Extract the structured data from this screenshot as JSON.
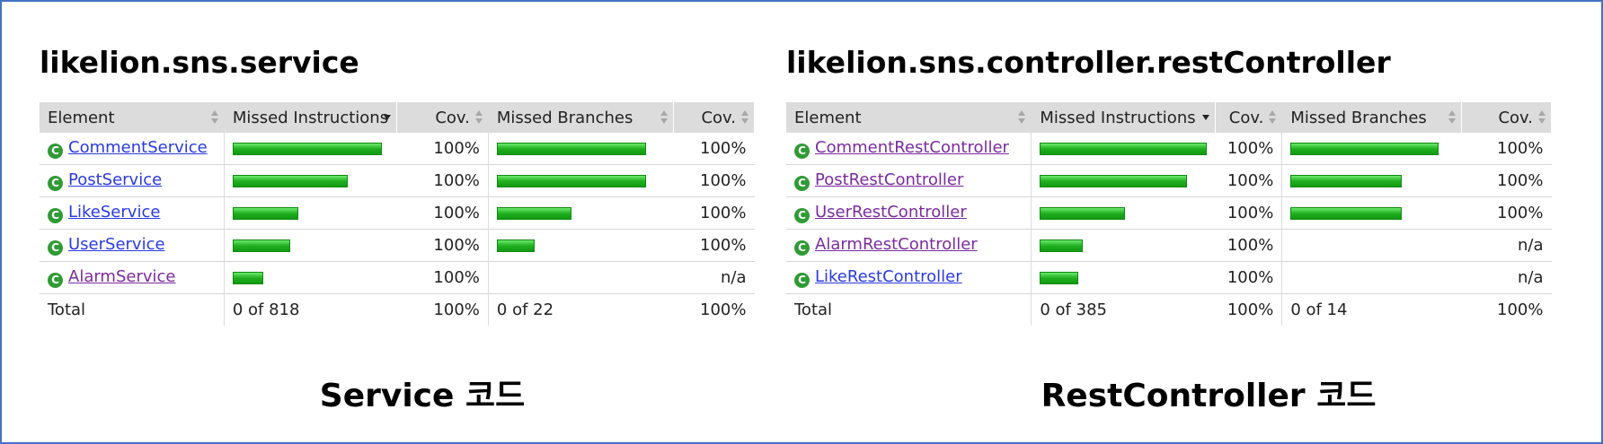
{
  "left": {
    "title": "likelion.sns.service",
    "headers": [
      "Element",
      "Missed Instructions",
      "Cov.",
      "Missed Branches",
      "Cov."
    ],
    "rows": [
      {
        "name": "CommentService",
        "link_color": "#2a3ae0",
        "instr_cov": 1.0,
        "instr_label": "100%",
        "branch_cov": 1.0,
        "branch_label": "100%"
      },
      {
        "name": "PostService",
        "link_color": "#2a3ae0",
        "instr_cov": 1.0,
        "instr_label": "100%",
        "branch_cov": 1.0,
        "branch_label": "100%"
      },
      {
        "name": "LikeService",
        "link_color": "#2a3ae0",
        "instr_cov": 1.0,
        "instr_label": "100%",
        "branch_cov": 1.0,
        "branch_label": "100%"
      },
      {
        "name": "UserService",
        "link_color": "#2a3ae0",
        "instr_cov": 1.0,
        "instr_label": "100%",
        "branch_cov": 1.0,
        "branch_label": "100%"
      },
      {
        "name": "AlarmService",
        "link_color": "#7b2c9e",
        "instr_cov": 1.0,
        "instr_label": "100%",
        "branch_cov": null,
        "branch_label": "n/a"
      }
    ],
    "total": {
      "label": "Total",
      "instr": "0 of 818",
      "instr_cov": "100%",
      "branch": "0 of 22",
      "branch_cov": "100%"
    },
    "caption": "Service 코드"
  },
  "right": {
    "title": "likelion.sns.controller.restController",
    "headers": [
      "Element",
      "Missed Instructions",
      "Cov.",
      "Missed Branches",
      "Cov."
    ],
    "rows": [
      {
        "name": "CommentRestController",
        "link_color": "#7b2c9e",
        "instr_cov": 1.0,
        "instr_label": "100%",
        "branch_cov": 1.0,
        "branch_label": "100%"
      },
      {
        "name": "PostRestController",
        "link_color": "#7b2c9e",
        "instr_cov": 1.0,
        "instr_label": "100%",
        "branch_cov": 1.0,
        "branch_label": "100%"
      },
      {
        "name": "UserRestController",
        "link_color": "#7b2c9e",
        "instr_cov": 1.0,
        "instr_label": "100%",
        "branch_cov": 1.0,
        "branch_label": "100%"
      },
      {
        "name": "AlarmRestController",
        "link_color": "#7b2c9e",
        "instr_cov": 1.0,
        "instr_label": "100%",
        "branch_cov": null,
        "branch_label": "n/a"
      },
      {
        "name": "LikeRestController",
        "link_color": "#2a3ae0",
        "instr_cov": 1.0,
        "instr_label": "100%",
        "branch_cov": null,
        "branch_label": "n/a"
      }
    ],
    "total": {
      "label": "Total",
      "instr": "0 of 385",
      "instr_cov": "100%",
      "branch": "0 of 14",
      "branch_cov": "100%"
    },
    "caption": "RestController 코드"
  },
  "icons": {
    "class_icon": "class-c-icon",
    "class_icon_glyph": "C",
    "class_icon_color": "#2f9b34",
    "bar_color": "#1fb01f"
  }
}
